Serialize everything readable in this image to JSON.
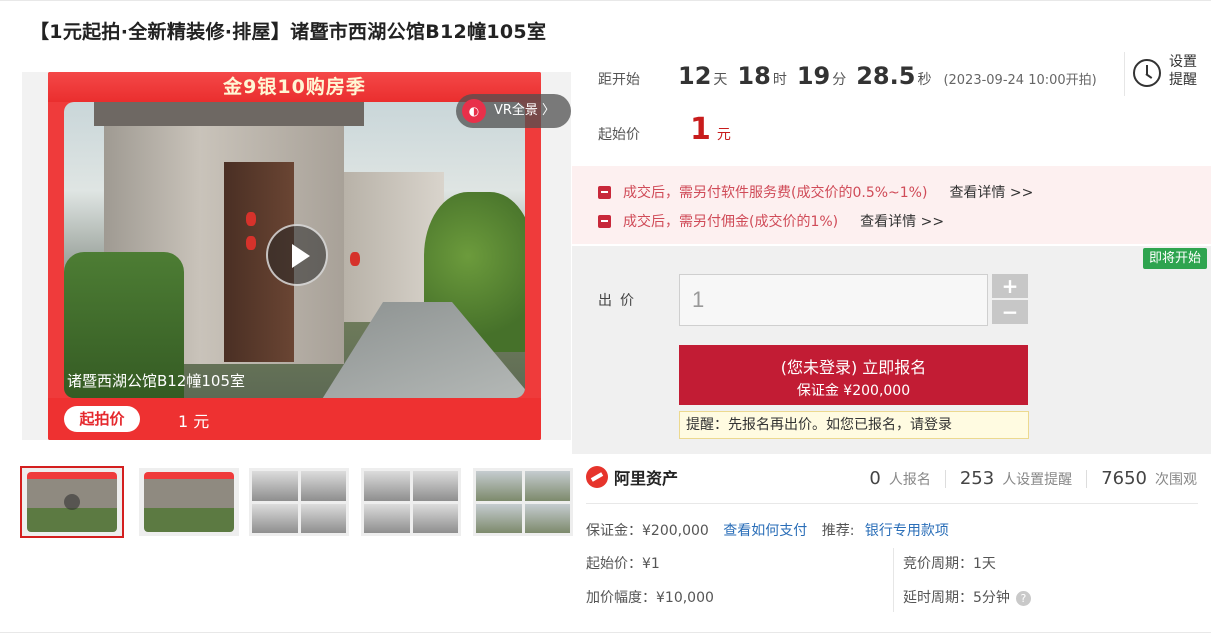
{
  "title": "【1元起拍·全新精装修·排屋】诸暨市西湖公馆B12幢105室",
  "poster": {
    "banner": "金9银10购房季",
    "caption": "诸暨西湖公馆B12幢105室",
    "start_pill": "起拍价",
    "start_value": "1 元",
    "vr_label": "VR全景 〉",
    "vr_icon_glyph": "◐"
  },
  "countdown": {
    "label": "距开始",
    "days": "12",
    "days_unit": "天",
    "hours": "18",
    "hours_unit": "时",
    "minutes": "19",
    "minutes_unit": "分",
    "seconds": "28.5",
    "seconds_unit": "秒",
    "start_date": "(2023-09-24 10:00开拍)"
  },
  "reminder": {
    "label": "设置提醒"
  },
  "start_price": {
    "label": "起始价",
    "value": "1",
    "unit": "元"
  },
  "fees": [
    {
      "text": "成交后，需另付软件服务费(成交价的0.5%~1%)",
      "link": "查看详情 >>"
    },
    {
      "text": "成交后，需另付佣金(成交价的1%)",
      "link": "查看详情 >>"
    }
  ],
  "bid": {
    "badge": "即将开始",
    "label": "出价",
    "input_value": "1",
    "plus": "+",
    "minus": "−",
    "signup_main": "(您未登录) 立即报名",
    "signup_sub": "保证金 ¥200,000",
    "tip_prefix": "提醒：先报名再出价。如您已报名，请",
    "tip_login": "登录"
  },
  "platform": {
    "name": "阿里资产"
  },
  "stats": [
    {
      "num": "0",
      "label": "人报名"
    },
    {
      "num": "253",
      "label": "人设置提醒"
    },
    {
      "num": "7650",
      "label": "次围观"
    }
  ],
  "info": {
    "deposit_label": "保证金：¥200,000",
    "deposit_link": "查看如何支付",
    "recommend_label": "推荐:",
    "recommend_link": "银行专用款项",
    "start_price": "起始价：¥1",
    "increment": "加价幅度：¥10,000",
    "bid_cycle": "竞价周期：1天",
    "delay_cycle": "延时周期：5分钟",
    "help_glyph": "?"
  },
  "colors": {
    "accent_red": "#c21c34",
    "price_red": "#c81c1c",
    "link_blue": "#2a6eb8",
    "badge_green": "#2ea44f"
  }
}
